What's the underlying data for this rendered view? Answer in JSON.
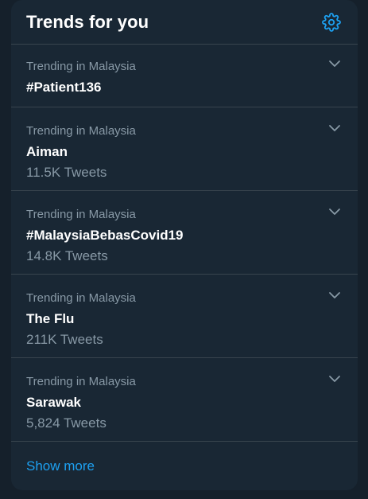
{
  "header": {
    "title": "Trends for you",
    "settings_icon": "gear-icon"
  },
  "trends": [
    {
      "context": "Trending in Malaysia",
      "name": "#Patient136",
      "count": ""
    },
    {
      "context": "Trending in Malaysia",
      "name": "Aiman",
      "count": "11.5K Tweets"
    },
    {
      "context": "Trending in Malaysia",
      "name": "#MalaysiaBebasCovid19",
      "count": "14.8K Tweets"
    },
    {
      "context": "Trending in Malaysia",
      "name": "The Flu",
      "count": "211K Tweets"
    },
    {
      "context": "Trending in Malaysia",
      "name": "Sarawak",
      "count": "5,824 Tweets"
    }
  ],
  "show_more": "Show more",
  "colors": {
    "background": "#15202b",
    "panel": "#192734",
    "accent": "#1da1f2",
    "muted": "#8899a6",
    "divider": "#38444d"
  }
}
